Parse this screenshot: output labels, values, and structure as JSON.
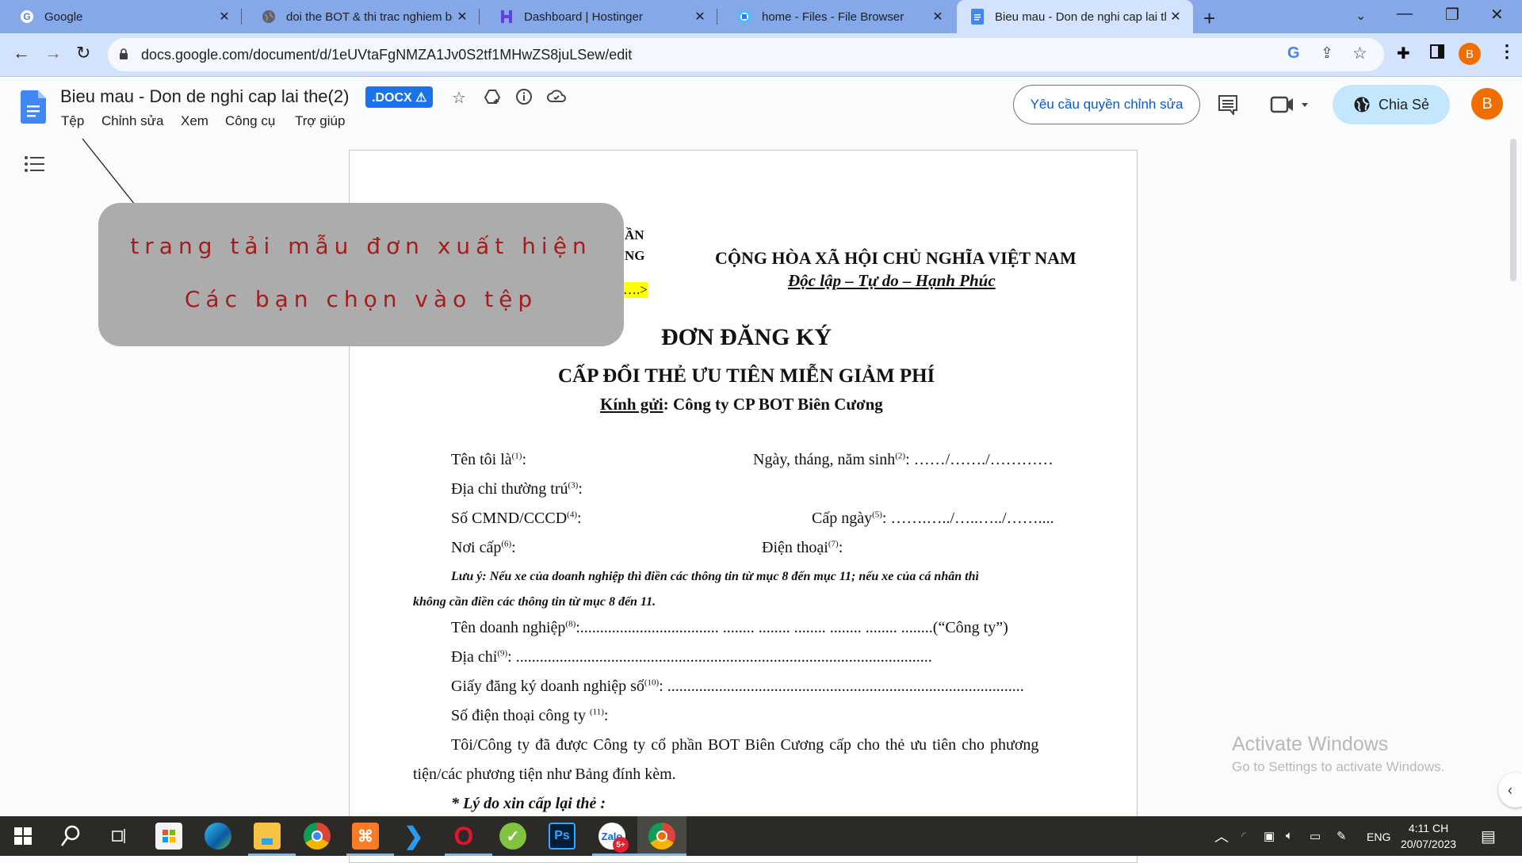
{
  "browser": {
    "tabs": [
      {
        "title": "Google",
        "icon": "google-icon",
        "active": false
      },
      {
        "title": "doi the BOT & thi trac nghiem bo",
        "icon": "globe-icon",
        "active": false
      },
      {
        "title": "Dashboard | Hostinger",
        "icon": "hostinger-icon",
        "active": false
      },
      {
        "title": "home - Files - File Browser",
        "icon": "file-browser-icon",
        "active": false
      },
      {
        "title": "Bieu mau - Don de nghi cap lai the",
        "icon": "google-docs-icon",
        "active": true
      }
    ],
    "new_tab": "+",
    "url": "docs.google.com/document/d/1eUVtaFgNMZA1Jv0S2tf1MHwZS8juLSew/edit",
    "profile_initial": "B",
    "window_controls": {
      "tab_search": "⌄",
      "minimize": "—",
      "restore": "❐",
      "close": "✕"
    }
  },
  "docs": {
    "title": "Bieu mau - Don de nghi cap lai the(2)",
    "badge": ".DOCX ⚠",
    "menus": [
      "Tệp",
      "Chỉnh sửa",
      "Xem",
      "Công cụ",
      "Trợ giúp"
    ],
    "request_edit_label": "Yêu cầu quyền chỉnh sửa",
    "share_label": "Chia Sẻ",
    "avatar_initial": "B"
  },
  "overlay": {
    "line1": "trang tải mẫu đơn xuất hiện",
    "line2": "Các bạn chọn vào tệp"
  },
  "document": {
    "left_header_partial_1": "ẦN",
    "left_header_partial_2": "NG",
    "left_header_highlight": "….>",
    "nation": "CỘNG HÒA XÃ HỘI CHỦ NGHĨA VIỆT NAM",
    "motto": "Độc lập – Tự do – Hạnh Phúc",
    "title": "ĐƠN ĐĂNG KÝ",
    "subtitle": "CẤP ĐỔI THẺ ƯU TIÊN MIỄN GIẢM PHÍ",
    "to_label": "Kính gửi",
    "to_value": ": Công ty CP BOT Biên Cương",
    "fields": {
      "name": "Tên tôi là",
      "name_sup": "(1)",
      "dob": "Ngày, tháng, năm sinh",
      "dob_sup": "(2)",
      "dob_fill": ": ……/……./…………",
      "address": "Địa chỉ thường trú",
      "address_sup": "(3)",
      "id": "Số CMND/CCCD",
      "id_sup": "(4)",
      "issue_date": "Cấp ngày",
      "issue_date_sup": "(5)",
      "issue_date_fill": ": …….…../…..…../……....",
      "issue_place": "Nơi cấp",
      "issue_place_sup": "(6)",
      "phone": "Điện thoại",
      "phone_sup": "(7)"
    },
    "note_line1": "Lưu ý: Nếu xe của doanh nghiệp thì điền các thông tin từ mục 8 đến mục 11; nếu xe của cá nhân thì",
    "note_line2": "không cần điền các thông tin từ mục 8 đến 11.",
    "company_fields": {
      "name": "Tên doanh nghiệp",
      "name_sup": "(8)",
      "name_fill": ":................................... ........ ........ ........ ........ ........ ........(“Công ty”)",
      "address": "Địa chỉ",
      "address_sup": "(9)",
      "address_fill": ": .........................................................................................................",
      "reg": "Giấy đăng ký doanh nghiệp số",
      "reg_sup": "(10)",
      "reg_fill": ": ..........................................................................................",
      "phone": "Số điện thoại công ty ",
      "phone_sup": "(11)"
    },
    "para_line1": "Tôi/Công ty đã được Công ty cổ phần BOT Biên Cương cấp cho thẻ ưu tiên cho phương",
    "para_line2": "tiện/các phương tiện như Bảng đính kèm.",
    "reason": "* Lý do xin cấp lại thẻ :"
  },
  "watermark": {
    "title": "Activate Windows",
    "subtitle": "Go to Settings to activate Windows."
  },
  "taskbar": {
    "apps": [
      "start",
      "search",
      "task-view",
      "microsoft-store",
      "edge",
      "file-explorer",
      "chrome",
      "xampp",
      "vscode",
      "opera",
      "coc-coc",
      "photoshop",
      "zalo",
      "chrome-profile"
    ],
    "zalo_badge": "5+",
    "language": "ENG",
    "time": "4:11 CH",
    "date": "20/07/2023"
  }
}
